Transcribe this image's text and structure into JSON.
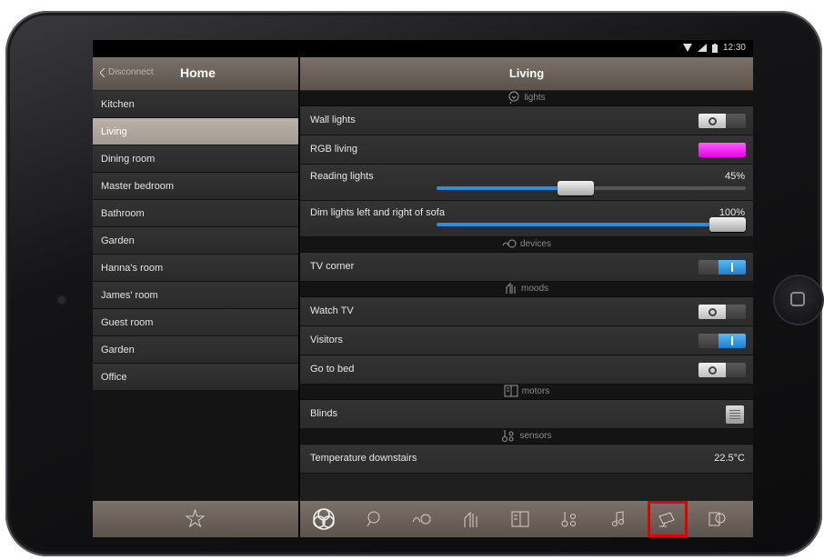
{
  "statusbar": {
    "time": "12:30"
  },
  "sidebar": {
    "back_label": "Disconnect",
    "title": "Home",
    "rooms": [
      {
        "label": "Kitchen",
        "selected": false
      },
      {
        "label": "Living",
        "selected": true
      },
      {
        "label": "Dining room",
        "selected": false
      },
      {
        "label": "Master bedroom",
        "selected": false
      },
      {
        "label": "Bathroom",
        "selected": false
      },
      {
        "label": "Garden",
        "selected": false
      },
      {
        "label": "Hanna's room",
        "selected": false
      },
      {
        "label": "James' room",
        "selected": false
      },
      {
        "label": "Guest room",
        "selected": false
      },
      {
        "label": "Garden",
        "selected": false
      },
      {
        "label": "Office",
        "selected": false
      }
    ],
    "footer_icon": "star-icon"
  },
  "main": {
    "title": "Living",
    "sections": {
      "lights": "lights",
      "devices": "devices",
      "moods": "moods",
      "motors": "motors",
      "sensors": "sensors"
    },
    "items": {
      "wall_lights": {
        "label": "Wall lights",
        "state": "off"
      },
      "rgb_living": {
        "label": "RGB living",
        "color": "#ff33ff"
      },
      "reading_lights": {
        "label": "Reading lights",
        "value": "45%",
        "level": 0.45
      },
      "dim_lights": {
        "label": "Dim lights left and right of sofa",
        "value": "100%",
        "level": 1.0
      },
      "tv_corner": {
        "label": "TV corner",
        "state": "on"
      },
      "watch_tv": {
        "label": "Watch TV",
        "state": "off"
      },
      "visitors": {
        "label": "Visitors",
        "state": "on"
      },
      "go_to_bed": {
        "label": "Go to bed",
        "state": "off"
      },
      "blinds": {
        "label": "Blinds"
      },
      "temperature": {
        "label": "Temperature downstairs",
        "value": "22.5°C"
      }
    },
    "tabs": [
      {
        "icon": "all-icon"
      },
      {
        "icon": "lights-icon"
      },
      {
        "icon": "devices-icon"
      },
      {
        "icon": "moods-icon"
      },
      {
        "icon": "motors-icon"
      },
      {
        "icon": "sensors-icon"
      },
      {
        "icon": "music-icon"
      },
      {
        "icon": "cameras-icon",
        "highlighted": true
      },
      {
        "icon": "settings-icon"
      }
    ]
  },
  "colors": {
    "accent": "#2b8de0",
    "highlight": "#e00000",
    "header": "#6b625b"
  }
}
